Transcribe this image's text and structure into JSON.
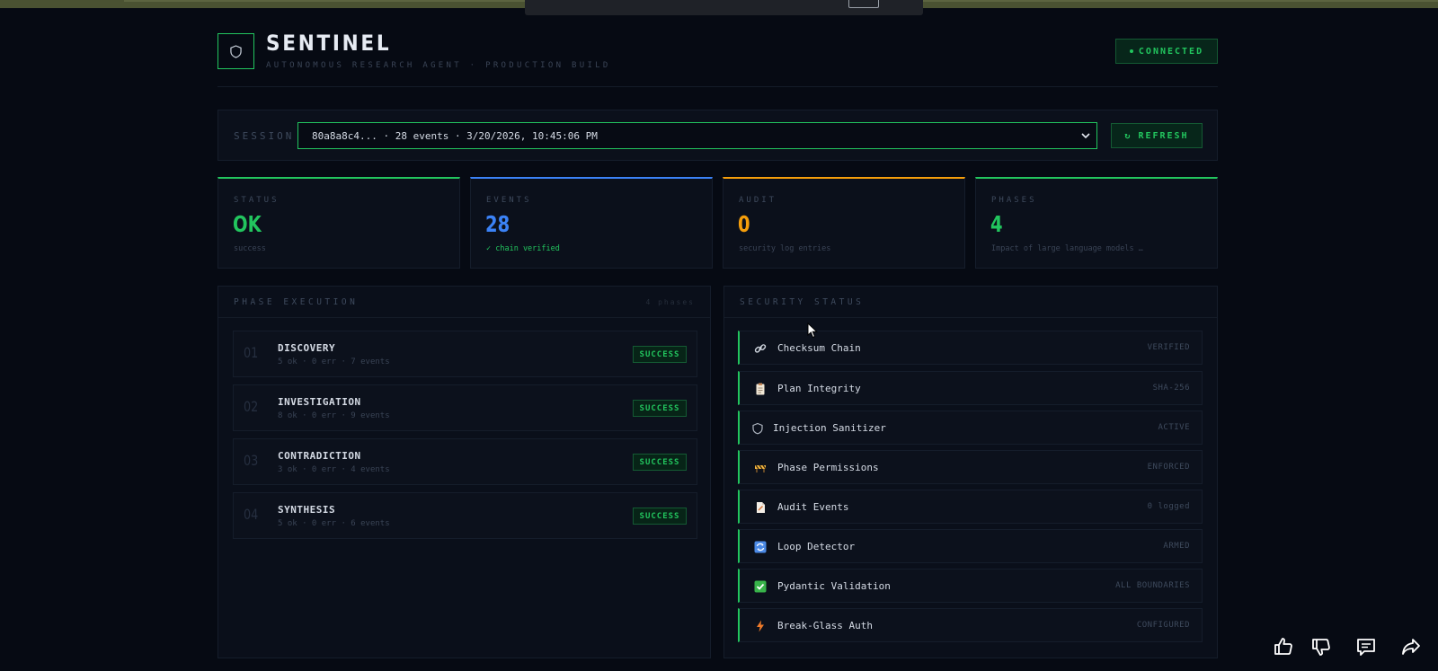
{
  "brand": {
    "title": "SENTINEL",
    "subtitle": "AUTONOMOUS RESEARCH AGENT · PRODUCTION BUILD",
    "connection": "CONNECTED"
  },
  "session": {
    "label": "SESSION",
    "selected": "80a8a8c4... · 28 events · 3/20/2026, 10:45:06 PM",
    "refresh_label": "REFRESH"
  },
  "stats": [
    {
      "label": "STATUS",
      "value": "OK",
      "sub": "success",
      "color": "#22c55e"
    },
    {
      "label": "EVENTS",
      "value": "28",
      "sub": "✓ chain verified",
      "color": "#3b82f6"
    },
    {
      "label": "AUDIT",
      "value": "0",
      "sub": "security log entries",
      "color": "#f59e0b"
    },
    {
      "label": "PHASES",
      "value": "4",
      "sub": "Impact of large language models …",
      "color": "#22c55e"
    }
  ],
  "phases_panel": {
    "title": "PHASE EXECUTION",
    "count": "4 phases",
    "items": [
      {
        "num": "01",
        "name": "DISCOVERY",
        "meta": "5 ok · 0 err · 7 events",
        "status": "SUCCESS"
      },
      {
        "num": "02",
        "name": "INVESTIGATION",
        "meta": "8 ok · 0 err · 9 events",
        "status": "SUCCESS"
      },
      {
        "num": "03",
        "name": "CONTRADICTION",
        "meta": "3 ok · 0 err · 4 events",
        "status": "SUCCESS"
      },
      {
        "num": "04",
        "name": "SYNTHESIS",
        "meta": "5 ok · 0 err · 6 events",
        "status": "SUCCESS"
      }
    ]
  },
  "security_panel": {
    "title": "SECURITY STATUS",
    "items": [
      {
        "name": "Checksum Chain",
        "status": "VERIFIED",
        "icon": "link-icon"
      },
      {
        "name": "Plan Integrity",
        "status": "SHA-256",
        "icon": "clipboard-icon"
      },
      {
        "name": "Injection Sanitizer",
        "status": "ACTIVE",
        "icon": "shield-icon"
      },
      {
        "name": "Phase Permissions",
        "status": "ENFORCED",
        "icon": "barrier-icon"
      },
      {
        "name": "Audit Events",
        "status": "0 logged",
        "icon": "document-icon"
      },
      {
        "name": "Loop Detector",
        "status": "ARMED",
        "icon": "loop-icon"
      },
      {
        "name": "Pydantic Validation",
        "status": "ALL BOUNDARIES",
        "icon": "checkbox-icon"
      },
      {
        "name": "Break-Glass Auth",
        "status": "CONFIGURED",
        "icon": "lightning-icon"
      }
    ]
  },
  "colors": {
    "accent": "#22c55e",
    "events": "#3b82f6",
    "audit": "#f59e0b",
    "background": "#060a13"
  }
}
